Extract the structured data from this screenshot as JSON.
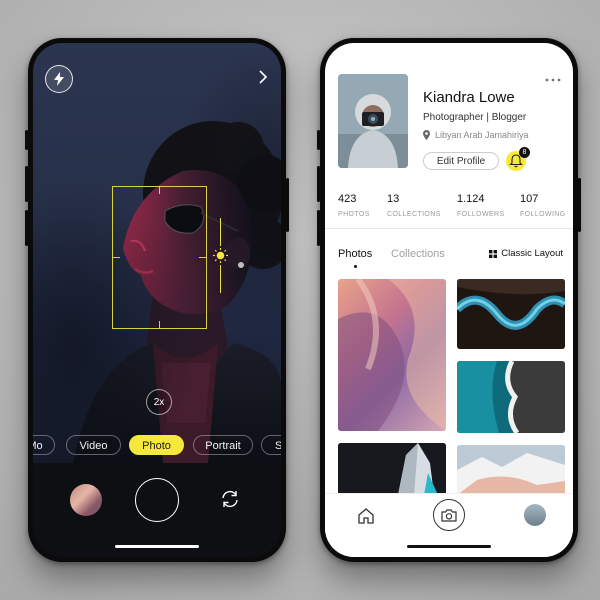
{
  "camera": {
    "zoom_label": "2x",
    "modes": [
      {
        "label": "Mo",
        "active": false
      },
      {
        "label": "Video",
        "active": false
      },
      {
        "label": "Photo",
        "active": true
      },
      {
        "label": "Portrait",
        "active": false
      },
      {
        "label": "Se",
        "active": false
      }
    ],
    "icons": {
      "flash": "flash-icon",
      "next": "chevron-right-icon",
      "exposure": "sun-icon",
      "flip": "camera-flip-icon"
    },
    "accent_color": "#f6e93c"
  },
  "profile": {
    "name": "Kiandra Lowe",
    "role": "Photographer | Blogger",
    "location": "Libyan Arab Jamahiriya",
    "edit_label": "Edit Profile",
    "notification_count": "8",
    "stats": [
      {
        "value": "423",
        "label": "PHOTOS"
      },
      {
        "value": "13",
        "label": "COLLECTIONS"
      },
      {
        "value": "1.124",
        "label": "FOLLOWERS"
      },
      {
        "value": "107",
        "label": "FOLLOWING"
      }
    ],
    "tabs": [
      {
        "label": "Photos",
        "active": true
      },
      {
        "label": "Collections",
        "active": false
      }
    ],
    "layout_toggle_label": "Classic Layout",
    "nav_icons": [
      "home-icon",
      "camera-icon",
      "avatar"
    ]
  }
}
